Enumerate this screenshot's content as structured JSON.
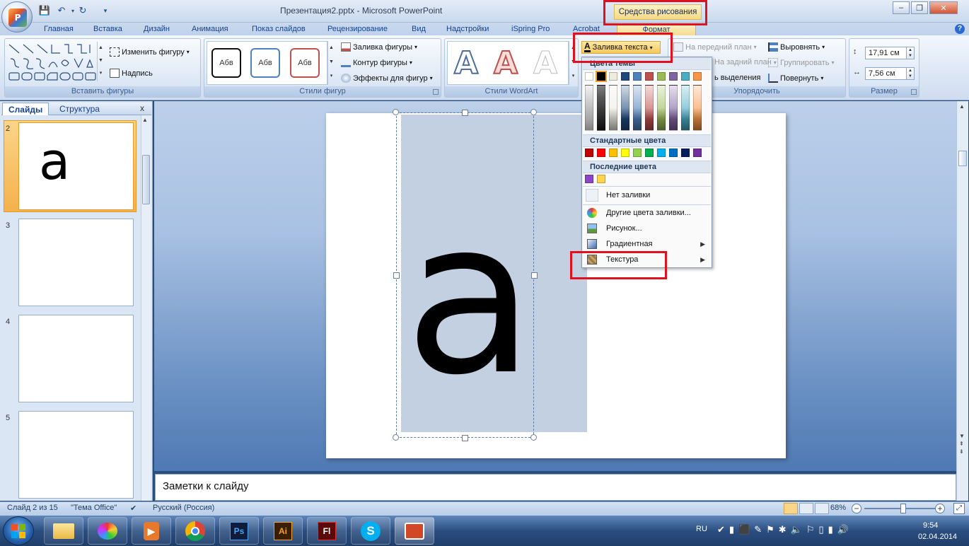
{
  "window": {
    "title": "Презентация2.pptx - Microsoft PowerPoint",
    "context_tool": "Средства рисования",
    "controls": [
      "–",
      "❐",
      "✕"
    ]
  },
  "tabs": [
    "Главная",
    "Вставка",
    "Дизайн",
    "Анимация",
    "Показ слайдов",
    "Рецензирование",
    "Вид",
    "Надстройки",
    "iSpring Pro",
    "Acrobat",
    "Формат"
  ],
  "ribbon": {
    "insert_shapes": {
      "label": "Вставить фигуры",
      "edit_shape": "Изменить фигуру",
      "textbox": "Надпись"
    },
    "shape_styles": {
      "label": "Стили фигур",
      "samples": [
        "Абв",
        "Абв",
        "Абв"
      ],
      "fill": "Заливка фигуры",
      "outline": "Контур фигуры",
      "effects": "Эффекты для фигур"
    },
    "wordart": {
      "label": "Стили WordArt",
      "samples": [
        "A",
        "A",
        "A"
      ],
      "text_fill": "Заливка текста"
    },
    "arrange": {
      "label": "Упорядочить",
      "bring_front": "На передний план",
      "send_back": "На задний план",
      "selection": "ь выделения",
      "align": "Выровнять",
      "group": "Группировать",
      "rotate": "Повернуть"
    },
    "size": {
      "label": "Размер",
      "height": "17,91 см",
      "width": "7,56 см"
    }
  },
  "left_pane": {
    "tabs": [
      "Слайды",
      "Структура"
    ],
    "close": "x",
    "slides": [
      {
        "number": "2",
        "content": "a",
        "selected": true
      },
      {
        "number": "3",
        "content": ""
      },
      {
        "number": "4",
        "content": ""
      },
      {
        "number": "5",
        "content": ""
      }
    ]
  },
  "slide": {
    "text": "a"
  },
  "notes": {
    "placeholder": "Заметки к слайду"
  },
  "text_fill_menu": {
    "section_theme": "Цвета темы",
    "section_standard": "Стандартные цвета",
    "section_recent": "Последние цвета",
    "theme_top_row": [
      "#ffffff",
      "#000000",
      "#eeece1",
      "#1f497d",
      "#4f81bd",
      "#c0504d",
      "#9bbb59",
      "#8064a2",
      "#4bacc6",
      "#f79646"
    ],
    "standard_colors": [
      "#c00000",
      "#ff0000",
      "#ffc000",
      "#ffff00",
      "#92d050",
      "#00b050",
      "#00b0f0",
      "#0070c0",
      "#002060",
      "#7030a0"
    ],
    "recent_colors": [
      "#8e44c8",
      "#ffd54f"
    ],
    "items": [
      "Нет заливки",
      "Другие цвета заливки...",
      "Рисунок...",
      "Градиентная",
      "Текстура"
    ]
  },
  "status": {
    "slide_counter": "Слайд 2 из 15",
    "theme": "\"Тема Office\"",
    "language": "Русский (Россия)",
    "zoom": "68%",
    "zoom_level": 0.55
  },
  "taskbar": {
    "apps": [
      "explorer",
      "paint",
      "media-player",
      "chrome",
      "Ps",
      "Ai",
      "Fl",
      "skype",
      "powerpoint"
    ],
    "lang": "RU",
    "time": "9:54",
    "date": "02.04.2014"
  }
}
